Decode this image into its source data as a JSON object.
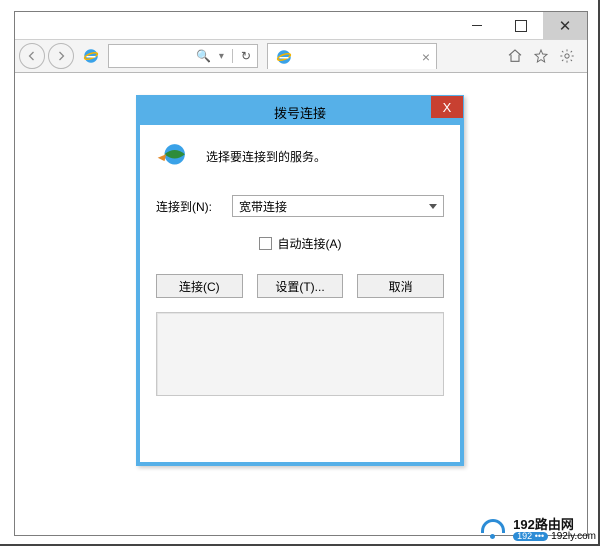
{
  "toolbar": {
    "search_glyph": "🔍",
    "refresh_glyph": "↻",
    "tab_close_glyph": "×"
  },
  "dialog": {
    "title": "拨号连接",
    "close_glyph": "X",
    "header_text": "选择要连接到的服务。",
    "connect_to_label": "连接到(N):",
    "connection_selected": "宽带连接",
    "auto_connect_label": "自动连接(A)",
    "buttons": {
      "connect": "连接(C)",
      "settings": "设置(T)...",
      "cancel": "取消"
    }
  },
  "watermark": {
    "title": "192路由网",
    "badge": "192 ••• ",
    "domain": "192ly.com"
  }
}
